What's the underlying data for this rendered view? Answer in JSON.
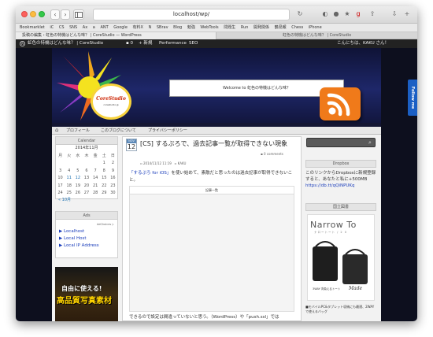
{
  "browser": {
    "url": "localhost/wp/",
    "back_label": "‹",
    "forward_label": "›",
    "bookmarks": [
      "Bookmarklet",
      "iC",
      "CS",
      "SNS",
      "Ax",
      "a",
      "ANT",
      "Google",
      "有料X",
      "N",
      "SBrav",
      "Blog",
      "勉強",
      "WebTools",
      "問題生",
      "Run",
      "開発関係",
      "鶴見報",
      "Chess",
      "iPhone"
    ],
    "tabs": [
      {
        "label": "投稿の編集 ‹ 虹色の特機はどんな味？ | CoreStudio — WordPress"
      },
      {
        "label": "虹色の特機はどんな味？ | CoreStudio"
      }
    ]
  },
  "adminbar": {
    "site_name": "虹色の特機はどんな味？ | CoreStudio",
    "comments": "0",
    "new_label": "+ 新規",
    "performance_label": "Performance",
    "seo_label": "SEO",
    "greeting": "こんにちは、KAKU さん！"
  },
  "header": {
    "logo_name": "CoreStudio",
    "logo_url": "corestudio.jp",
    "welcome_text": "Welcome to 虹色の特機はどんな味？"
  },
  "nav": {
    "items": [
      "プロフィール",
      "このブログについて",
      "プライバシーポリシー"
    ]
  },
  "calendar": {
    "title": "Calendar",
    "caption": "2014年11月",
    "weekdays": [
      "月",
      "火",
      "水",
      "木",
      "金",
      "土",
      "日"
    ],
    "rows": [
      [
        "",
        "",
        "",
        "",
        "",
        "1",
        "2"
      ],
      [
        "3",
        "4",
        "5",
        "6",
        "7",
        "8",
        "9"
      ],
      [
        "10",
        "11",
        "12",
        "13",
        "14",
        "15",
        "16"
      ],
      [
        "17",
        "18",
        "19",
        "20",
        "21",
        "22",
        "23"
      ],
      [
        "24",
        "25",
        "26",
        "27",
        "28",
        "29",
        "30"
      ]
    ],
    "prev_link": "« 10月"
  },
  "ads": {
    "title": "Ads",
    "adchoices": "AdChoices ▷",
    "links": [
      "▶ Localhost",
      "▶ Local Host",
      "▶ Local IP Address"
    ],
    "photo_line1": "自由に使える!",
    "photo_line2": "高品質写真素材"
  },
  "post": {
    "month": "NOV",
    "day": "12",
    "title": "[CS] するぷろで、過去記事一覧が取得できない現象",
    "comments": "0 comments",
    "date": "2014/11/12 11:19",
    "author": "KAKU",
    "body_link": "「するぷろ for iOS」",
    "body_text": "を使い始めて、素敵だと思ったのは過去記事が取得できないこと。",
    "screenshot_title": "記事一覧",
    "bottom_text": "できるので設定は間違っていないと思う。（WordPress）や「push.ssl」では"
  },
  "sidebar": {
    "dropbox_title": "Dropbox",
    "dropbox_text": "このリンクからDropboxに新規登録すると、あなたと私に+500MB",
    "dropbox_link": "https://db.tt/qQiNPUKq",
    "book_title": "国立図書",
    "book_ad_title": "Narrow To",
    "book_ad_sub": "ナロートート / 2 0",
    "book_ad_caption": "3WAY 背負えるトート",
    "book_ad_brand": "Made",
    "bottom_text": "■モバイルPC&タブレット収納にも最適、2WAYで使えるバッグ"
  },
  "follow_label": "Follow me",
  "colors": {
    "admin_bar": "#222222",
    "link": "#1a3dbb",
    "rss": "#f07a1a",
    "follow": "#1b5fc4",
    "site_background": "#141633"
  },
  "icons": [
    "sidebar-icon",
    "share-icon",
    "plus-icon",
    "download-icon",
    "wordpress-icon",
    "rss-icon",
    "home-icon",
    "search-icon"
  ]
}
